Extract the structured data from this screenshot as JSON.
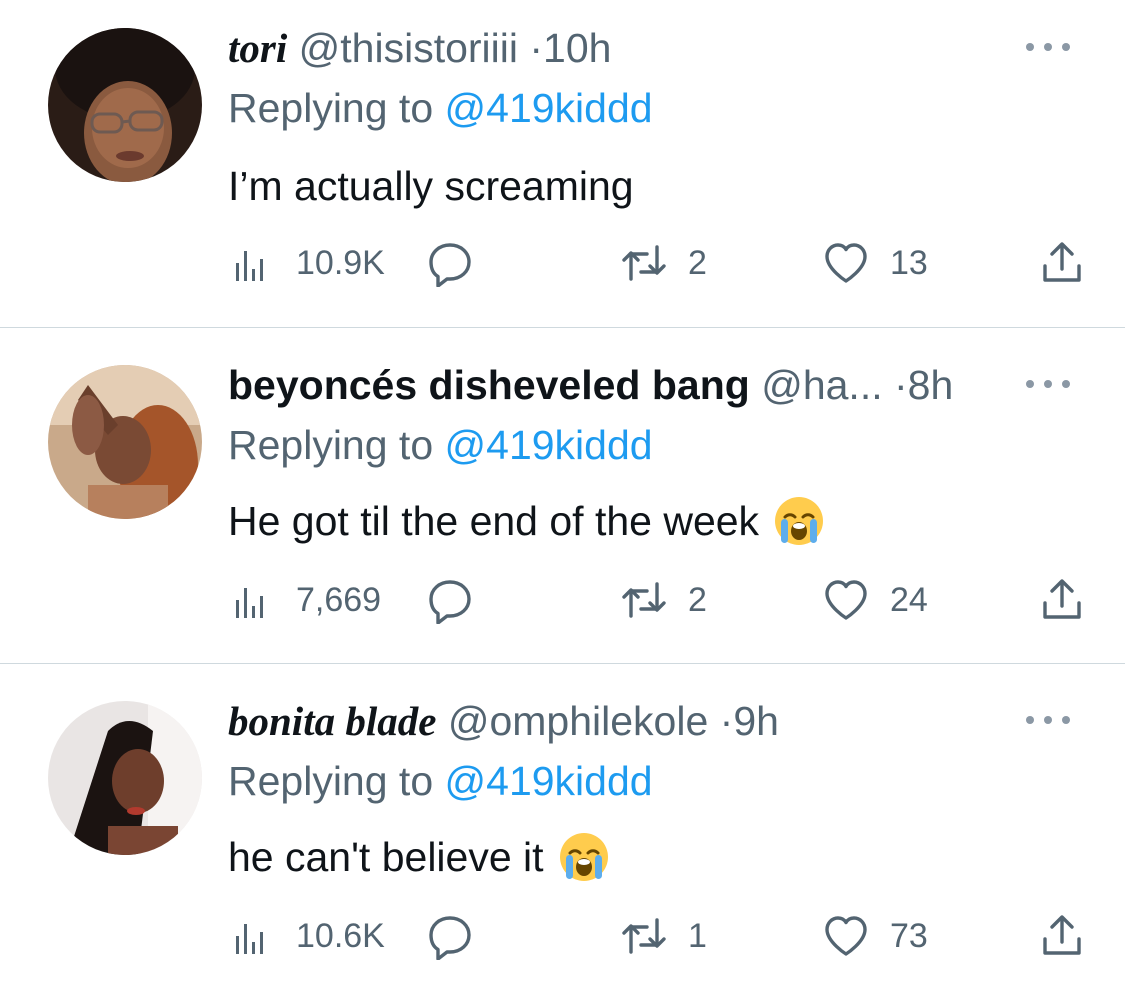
{
  "replies": [
    {
      "display_name": "tori",
      "handle": "@thisistoriiii",
      "separator": "·",
      "time": "10h",
      "replying_prefix": "Replying to",
      "replying_to": "@419kiddd",
      "text": "I’m actually screaming",
      "emoji": "",
      "stats": {
        "views": "10.9K",
        "retweets": "2",
        "likes": "13"
      }
    },
    {
      "display_name": "beyoncés disheveled bang",
      "handle": "@ha...",
      "separator": "·",
      "time": "8h",
      "replying_prefix": "Replying to",
      "replying_to": "@419kiddd",
      "text": "He got til the end of the week",
      "emoji": "loudly-crying-face",
      "stats": {
        "views": "7,669",
        "retweets": "2",
        "likes": "24"
      }
    },
    {
      "display_name": "bonita blade",
      "handle": "@omphilekole",
      "separator": "·",
      "time": "9h",
      "replying_prefix": "Replying to",
      "replying_to": "@419kiddd",
      "text": "he can't believe it",
      "emoji": "loudly-crying-face",
      "stats": {
        "views": "10.6K",
        "retweets": "1",
        "likes": "73"
      }
    }
  ],
  "icons": {
    "views": "bar-chart-icon",
    "reply": "reply-bubble-icon",
    "retweet": "retweet-icon",
    "like": "heart-icon",
    "share": "share-icon",
    "more": "more-dots-icon"
  },
  "colors": {
    "text": "#0f1419",
    "secondary": "#536471",
    "link": "#1d9bf0",
    "divider": "#cfd9de"
  }
}
